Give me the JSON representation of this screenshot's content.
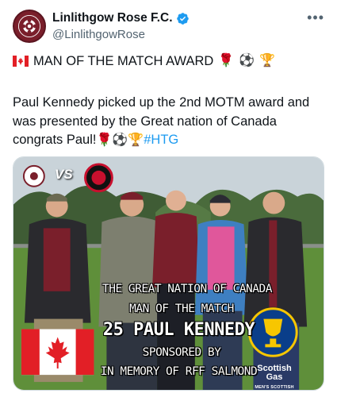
{
  "tweet": {
    "author": {
      "display_name": "Linlithgow Rose F.C.",
      "handle": "@LinlithgowRose",
      "verified": true,
      "avatar_icon": "club-crest-icon"
    },
    "more_label": "•••",
    "headline": {
      "text": "MAN OF THE MATCH AWARD",
      "leading_icon": "canada-flag-icon",
      "trailing_emojis": [
        "🌹",
        "⚽",
        "🏆"
      ]
    },
    "body": {
      "text_part1": "Paul Kennedy picked up the 2nd MOTM award and was presented by the Great nation of Canada congrats Paul!",
      "emojis": [
        "🌹",
        "⚽",
        "🏆"
      ],
      "hashtag": "#HTG"
    },
    "media": {
      "vs_label": "VS",
      "overlay": {
        "line1": "THE GREAT NATION OF CANADA",
        "line2": "MAN OF THE MATCH",
        "line3": "25 PAUL KENNEDY",
        "line4": "SPONSORED BY",
        "line5": "IN MEMORY OF RFF SALMOND"
      },
      "sponsor": {
        "name": "Scottish Gas",
        "sub": "MEN'S SCOTTISH CUP"
      },
      "colors": {
        "maroon": "#7a1f2b",
        "canada_red": "#e21f26",
        "cup_blue": "#0a3e8a",
        "cup_gold": "#f7c600"
      }
    }
  },
  "colors": {
    "text": "#0f1419",
    "secondary": "#536471",
    "link": "#1d9bf0",
    "verified": "#1d9bf0"
  }
}
